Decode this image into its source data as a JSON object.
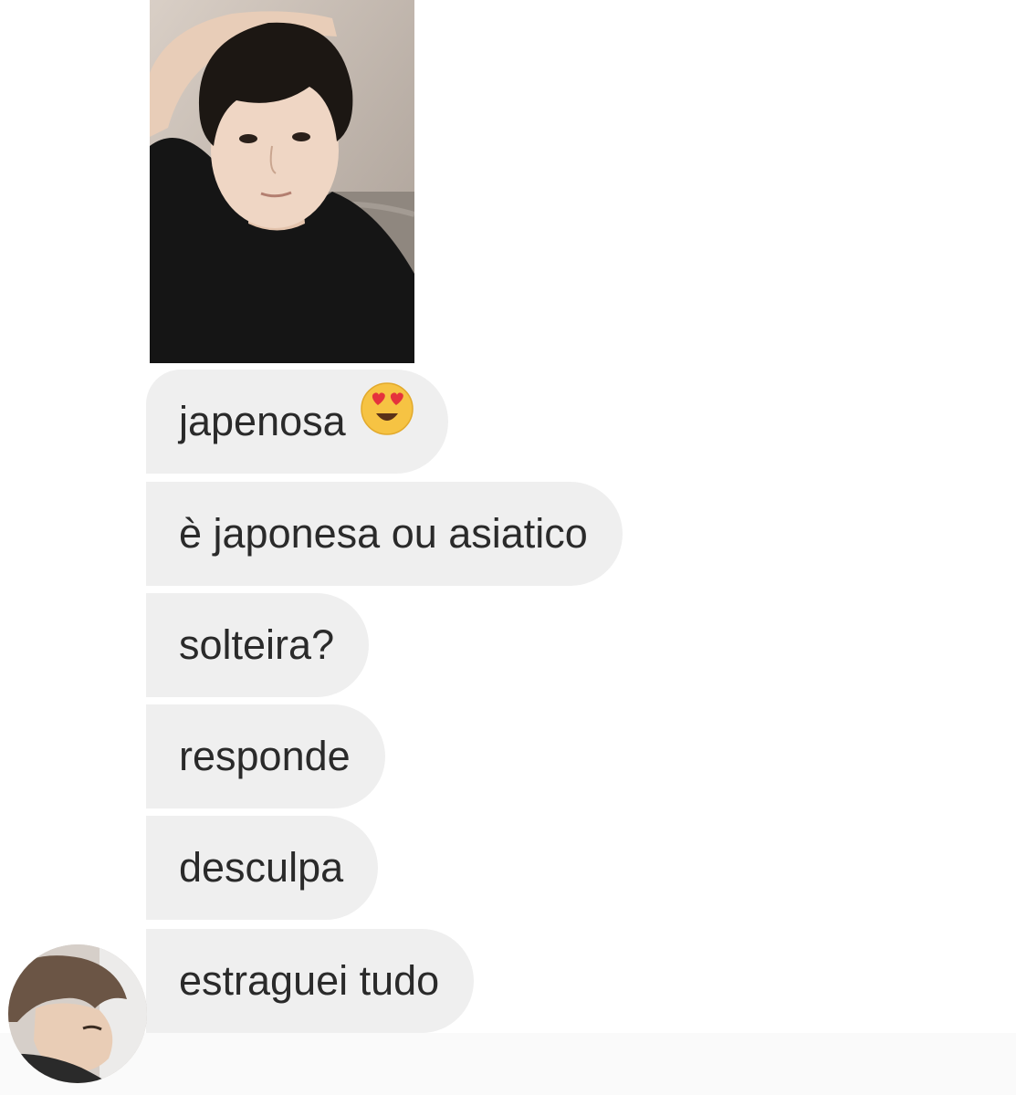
{
  "messages": [
    {
      "text": "japenosa",
      "emoji": "heart-eyes-emoji"
    },
    {
      "text": "è japonesa ou asiatico"
    },
    {
      "text": "solteira?"
    },
    {
      "text": "responde"
    },
    {
      "text": "desculpa"
    },
    {
      "text": "estraguei tudo"
    }
  ],
  "colors": {
    "bubble": "#efefef",
    "text": "#2a2a2a",
    "background": "#ffffff"
  }
}
